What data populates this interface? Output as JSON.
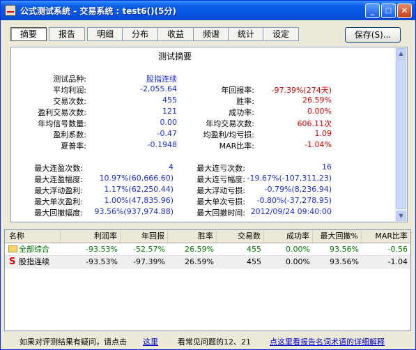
{
  "window": {
    "title": "公式测试系统 - 交易系统 : test6()(5分)",
    "min": "_",
    "max": "□",
    "close": "✕"
  },
  "tabs": [
    "摘要",
    "报告",
    "明细",
    "分布",
    "收益",
    "频谱",
    "统计",
    "设定"
  ],
  "save_label": "保存(S)...",
  "report": {
    "title": "测试摘要",
    "left": [
      {
        "label": "测试品种:",
        "value": "股指连续"
      },
      {
        "label": "平均利润:",
        "value": "-2,055.64"
      },
      {
        "label": "交易次数:",
        "value": "455"
      },
      {
        "label": "盈利交易次数:",
        "value": "121"
      },
      {
        "label": "年均信号数量:",
        "value": "0.00"
      },
      {
        "label": "盈利系数:",
        "value": "-0.47"
      },
      {
        "label": "夏普率:",
        "value": "-0.1948"
      }
    ],
    "right": [
      {
        "label": "年回报率:",
        "value": "-97.39%(274天)"
      },
      {
        "label": "胜率:",
        "value": "26.59%"
      },
      {
        "label": "成功率:",
        "value": "0.00%"
      },
      {
        "label": "年均交易次数:",
        "value": "606.11次"
      },
      {
        "label": "均盈利/均亏损:",
        "value": "1.09"
      },
      {
        "label": "MAR比率:",
        "value": "-1.04%"
      }
    ],
    "left2": [
      {
        "label": "最大连盈次数:",
        "value": "4"
      },
      {
        "label": "最大连盈幅度:",
        "value": "10.97%(60,666.60)"
      },
      {
        "label": "最大浮动盈利:",
        "value": "1.17%(62,250.44)"
      },
      {
        "label": "最大单次盈利:",
        "value": "1.00%(47,835.96)"
      },
      {
        "label": "最大回撤幅度:",
        "value": "93.56%(937,974.88)"
      }
    ],
    "right2": [
      {
        "label": "最大连亏次数:",
        "value": "16"
      },
      {
        "label": "最大连亏幅度:",
        "value": "-19.67%(-107,311.23)"
      },
      {
        "label": "最大浮动亏损:",
        "value": "-0.79%(8,236.94)"
      },
      {
        "label": "最大单次亏损:",
        "value": "-0.80%(-37,278.95)"
      },
      {
        "label": "最大回撤时间:",
        "value": "2012/09/24 09:40:00"
      }
    ]
  },
  "grid": {
    "headers": [
      "名称",
      "利润率",
      "年回报",
      "胜率",
      "交易数",
      "成功率",
      "最大回撤%",
      "MAR比率"
    ],
    "rows": [
      {
        "name": "全部综合",
        "cells": [
          "-93.53%",
          "-52.57%",
          "26.59%",
          "455",
          "0.00%",
          "93.56%",
          "-0.56"
        ]
      },
      {
        "name": "股指连续",
        "cells": [
          "-93.53%",
          "-97.39%",
          "26.59%",
          "455",
          "0.00%",
          "93.56%",
          "-1.04"
        ]
      }
    ]
  },
  "footer": {
    "question_text": "如果对评测结果有疑问，请点击",
    "here_link": "这里",
    "faq_text": "看常见问题的12、21",
    "glossary_link": "点这里看报告名词术语的详细解释"
  }
}
